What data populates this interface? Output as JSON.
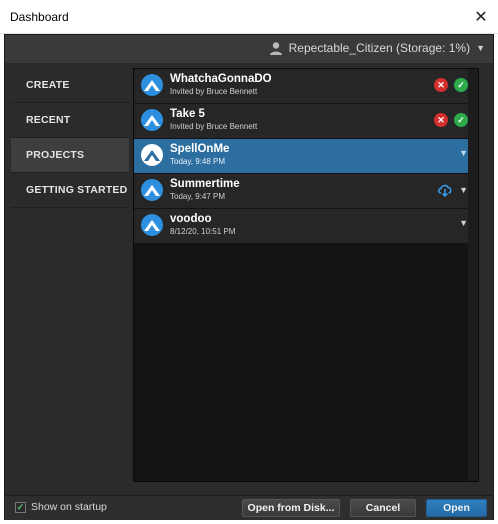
{
  "window": {
    "title": "Dashboard",
    "close_glyph": "✕"
  },
  "account": {
    "user_label": "Repectable_Citizen (Storage: 1%)",
    "icon": "user-icon",
    "caret": "▼"
  },
  "sidebar": {
    "items": [
      {
        "label": "CREATE"
      },
      {
        "label": "RECENT"
      },
      {
        "label": "PROJECTS",
        "active": true
      },
      {
        "label": "GETTING STARTED"
      }
    ]
  },
  "projects": [
    {
      "name": "WhatchaGonnaDO",
      "sub": "Invited by Bruce Bennett",
      "actions": "invite"
    },
    {
      "name": "Take 5",
      "sub": "Invited by Bruce Bennett",
      "actions": "invite"
    },
    {
      "name": "SpellOnMe",
      "sub": "Today, 9:48 PM",
      "actions": "menu",
      "selected": true
    },
    {
      "name": "Summertime",
      "sub": "Today, 9:47 PM",
      "actions": "download"
    },
    {
      "name": "voodoo",
      "sub": "8/12/20, 10:51 PM",
      "actions": "menu"
    }
  ],
  "glyphs": {
    "decline": "✕",
    "accept": "✓",
    "menu_caret": "▼",
    "check": "✓"
  },
  "footer": {
    "show_on_startup_label": "Show on startup",
    "show_on_startup_checked": true,
    "open_from_disk_label": "Open from Disk...",
    "cancel_label": "Cancel",
    "open_label": "Open"
  },
  "colors": {
    "accent": "#2d6ea0",
    "decline": "#d32f2f",
    "accept": "#2eaa4a",
    "panel_dark": "#141414",
    "logo_blue": "#2d8fe0"
  }
}
